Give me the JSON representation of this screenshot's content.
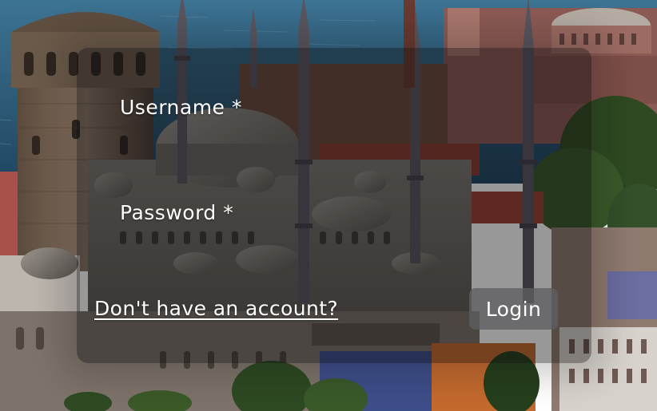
{
  "form": {
    "username_label": "Username *",
    "username_value": "",
    "password_label": "Password *",
    "password_value": "",
    "signup_link": "Don't have an account?",
    "login_button": "Login"
  },
  "colors": {
    "text": "#ffffff",
    "panel_overlay": "#0a0a0c",
    "button_bg": "#5f5f62",
    "sea": "#2d5a78",
    "stone": "#6e6258",
    "roof_red": "#8a3a2e"
  },
  "background": {
    "subject": "city-skyline-photo"
  }
}
